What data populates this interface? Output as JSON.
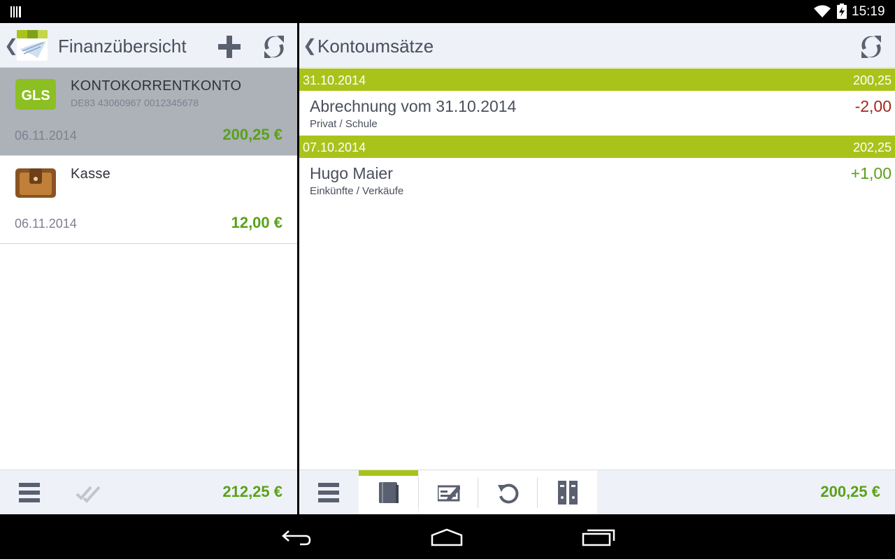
{
  "status_bar": {
    "time": "15:19"
  },
  "left_pane": {
    "title": "Finanzübersicht",
    "back_glyph": "❮",
    "accounts": [
      {
        "icon": "gls-bank-icon",
        "icon_text": "GLS",
        "name": "KONTOKORRENTKONTO",
        "iban": "DE83 43060967 0012345678",
        "date": "06.11.2014",
        "balance": "200,25 €",
        "selected": true
      },
      {
        "icon": "wallet-icon",
        "name": "Kasse",
        "iban": "",
        "date": "06.11.2014",
        "balance": "12,00 €",
        "selected": false
      }
    ],
    "total": "212,25 €"
  },
  "right_pane": {
    "title": "Kontoumsätze",
    "back_glyph": "❮",
    "groups": [
      {
        "date": "31.10.2014",
        "balance": "200,25",
        "transactions": [
          {
            "name": "Abrechnung vom  31.10.2014",
            "category": "Privat / Schule",
            "amount": "-2,00"
          }
        ]
      },
      {
        "date": "07.10.2014",
        "balance": "202,25",
        "transactions": [
          {
            "name": "Hugo Maier",
            "category": "Einkünfte / Verkäufe",
            "amount": "+1,00"
          }
        ]
      }
    ],
    "tabs": [
      "book-icon",
      "transfer-icon",
      "history-icon",
      "binders-icon"
    ],
    "total": "200,25 €"
  },
  "colors": {
    "accent_green": "#a9c31a",
    "positive": "#5aa11a",
    "negative": "#a3281d",
    "selected_bg": "#adb1b8",
    "bar_bg": "#eef1f8"
  }
}
